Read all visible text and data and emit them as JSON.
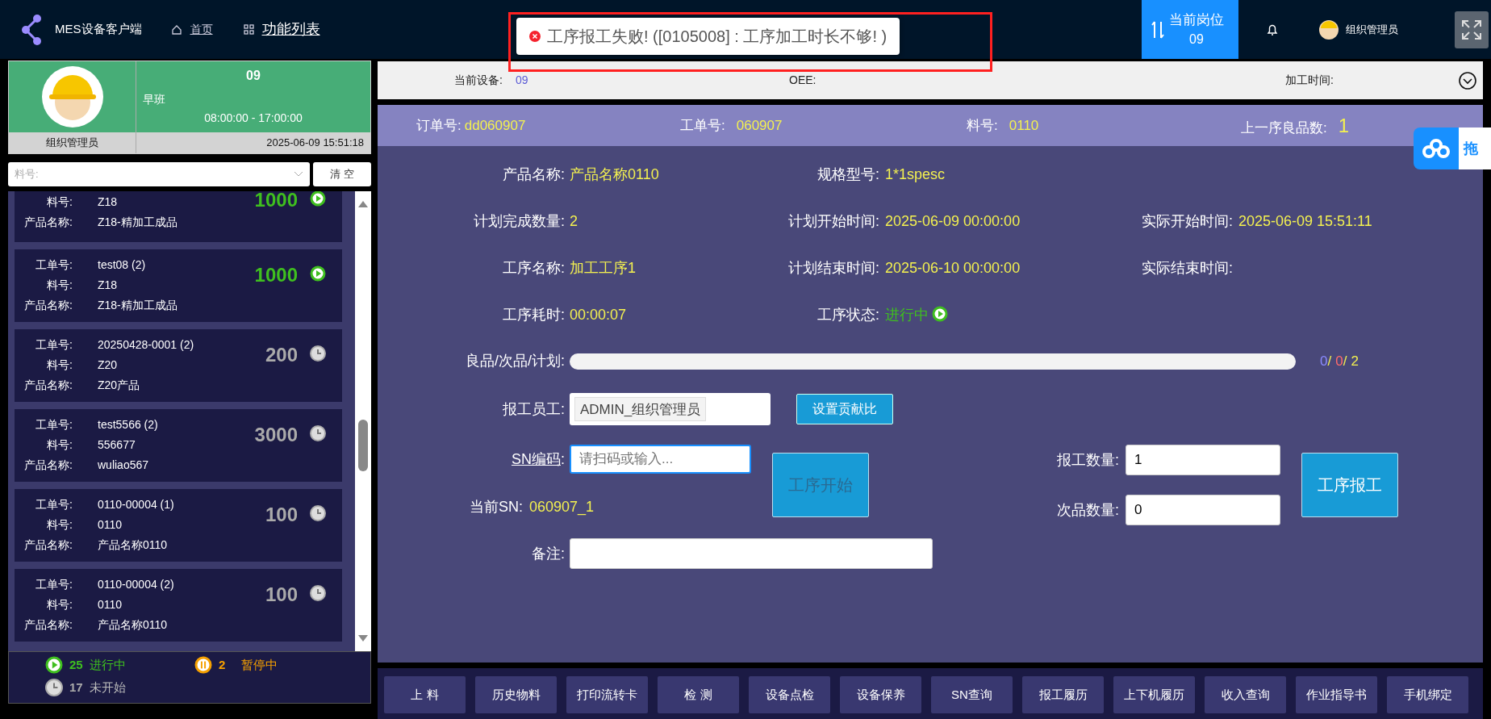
{
  "header": {
    "app_title": "MES设备客户端",
    "nav": [
      {
        "label": "首页",
        "selected": false
      },
      {
        "label": "功能列表",
        "selected": true
      }
    ],
    "station": {
      "label": "当前岗位",
      "value": "09"
    },
    "user": "组织管理员"
  },
  "toast": {
    "kind": "error",
    "message": "工序报工失败! ([0105008] : 工序加工时长不够! )"
  },
  "profile": {
    "role": "组织管理员",
    "station": "09",
    "shift": "早班",
    "shift_time": "08:00:00 - 17:00:00",
    "datetime": "2025-06-09 15:51:18"
  },
  "filter": {
    "placeholder": "料号:",
    "clear_button": "清 空"
  },
  "work_orders": [
    {
      "kind": "running",
      "fields": [
        {
          "label": "料号:",
          "value": "Z18"
        },
        {
          "label": "产品名称:",
          "value": "Z18-精加工成品"
        }
      ],
      "quantity": "1000"
    },
    {
      "kind": "running",
      "fields": [
        {
          "label": "工单号:",
          "value": "test08 (2)"
        },
        {
          "label": "料号:",
          "value": "Z18"
        },
        {
          "label": "产品名称:",
          "value": "Z18-精加工成品"
        }
      ],
      "quantity": "1000"
    },
    {
      "kind": "waiting",
      "fields": [
        {
          "label": "工单号:",
          "value": "20250428-0001 (2)"
        },
        {
          "label": "料号:",
          "value": "Z20"
        },
        {
          "label": "产品名称:",
          "value": "Z20产品"
        }
      ],
      "quantity": "200"
    },
    {
      "kind": "waiting",
      "fields": [
        {
          "label": "工单号:",
          "value": "test5566 (2)"
        },
        {
          "label": "料号:",
          "value": "556677"
        },
        {
          "label": "产品名称:",
          "value": "wuliao567"
        }
      ],
      "quantity": "3000"
    },
    {
      "kind": "waiting",
      "fields": [
        {
          "label": "工单号:",
          "value": "0110-00004 (1)"
        },
        {
          "label": "料号:",
          "value": "0110"
        },
        {
          "label": "产品名称:",
          "value": "产品名称0110"
        }
      ],
      "quantity": "100"
    },
    {
      "kind": "waiting",
      "fields": [
        {
          "label": "工单号:",
          "value": "0110-00004 (2)"
        },
        {
          "label": "料号:",
          "value": "0110"
        },
        {
          "label": "产品名称:",
          "value": "产品名称0110"
        }
      ],
      "quantity": "100"
    }
  ],
  "status_counts": [
    {
      "kind": "running",
      "count": "25",
      "label": "进行中"
    },
    {
      "kind": "paused",
      "count": "2",
      "label": "暂停中"
    },
    {
      "kind": "waiting",
      "count": "17",
      "label": "未开始"
    }
  ],
  "device_bar": [
    {
      "label": "当前设备:",
      "value": "09"
    },
    {
      "label": "OEE:"
    },
    {
      "label": "加工时间:"
    }
  ],
  "order_header": [
    {
      "label": "订单号:",
      "value": "dd060907"
    },
    {
      "label": "工单号:",
      "value": "060907"
    },
    {
      "label": "料号:",
      "value": "0110"
    },
    {
      "label": "上一序良品数:",
      "value": "1"
    }
  ],
  "details": [
    [
      {
        "label": "产品名称:",
        "value": "产品名称0110"
      },
      {
        "label": "规格型号:",
        "value": "1*1spesc"
      }
    ],
    [
      {
        "label": "计划完成数量:",
        "value": "2"
      },
      {
        "label": "计划开始时间:",
        "value": "2025-06-09 00:00:00"
      },
      {
        "label": "实际开始时间:",
        "value": "2025-06-09 15:51:11"
      }
    ],
    [
      {
        "label": "工序名称:",
        "value": "加工工序1"
      },
      {
        "label": "计划结束时间:",
        "value": "2025-06-10 00:00:00"
      },
      {
        "label": "实际结束时间:"
      }
    ],
    [
      {
        "label": "工序耗时:",
        "value": "00:00:07"
      },
      {
        "label": "工序状态:",
        "value": "进行中",
        "kind": "status"
      }
    ]
  ],
  "progress": {
    "label": "良品/次品/计划:",
    "level": 0,
    "counts": [
      {
        "kind": "good",
        "text": "0"
      },
      {
        "kind": "separator",
        "text": "/"
      },
      {
        "kind": "defect",
        "text": "0"
      },
      {
        "kind": "separator",
        "text": "/"
      },
      {
        "kind": "plan",
        "text": "2"
      }
    ]
  },
  "workers": {
    "label": "报工员工:",
    "tags": [
      "ADMIN_组织管理员"
    ],
    "button": "设置贡献比"
  },
  "sn": {
    "label": "SN编码",
    "colon": ":",
    "placeholder": "请扫码或输入...",
    "current_label": "当前SN:",
    "current_value": "060907_1"
  },
  "start_button": {
    "label": "工序开始",
    "disabled": true
  },
  "report_qty": {
    "label": "报工数量:",
    "value": "1"
  },
  "defect_qty": {
    "label": "次品数量:",
    "value": "0"
  },
  "report_button": "工序报工",
  "remark": {
    "label": "备注:"
  },
  "drag_widget": "拖",
  "toolbar": [
    "上 料",
    "历史物料",
    "打印流转卡",
    "检 测",
    "设备点检",
    "设备保养",
    "SN查询",
    "报工履历",
    "上下机履历",
    "收入查询",
    "作业指导书",
    "手机绑定"
  ]
}
